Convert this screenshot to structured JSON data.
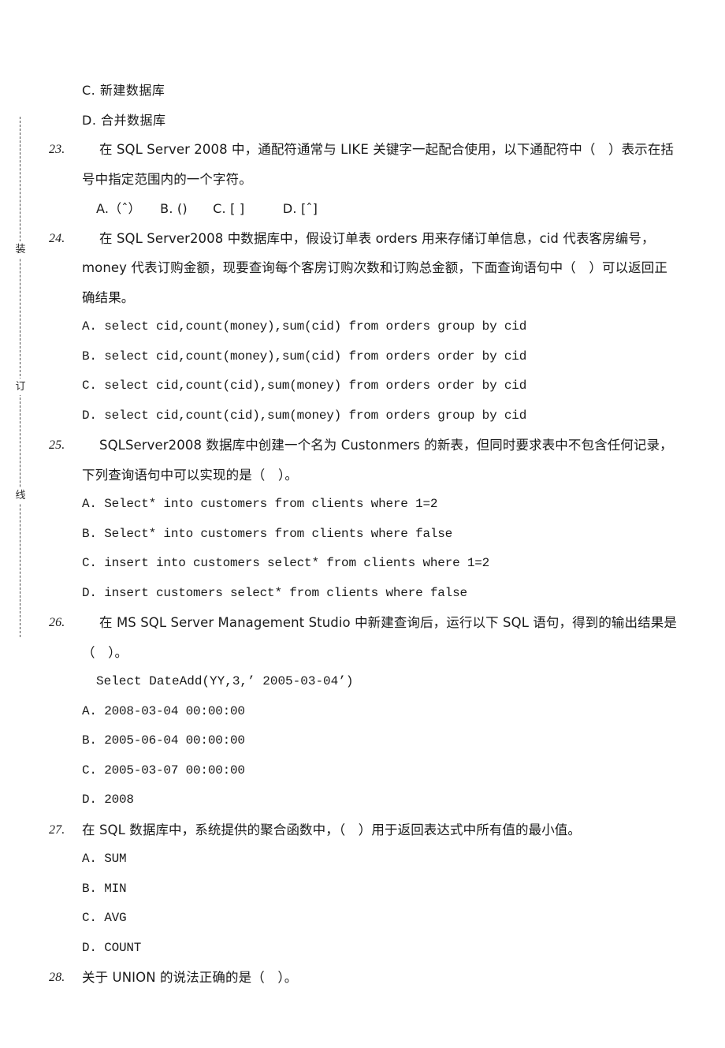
{
  "page": {
    "binding_margin": {
      "characters": [
        "装",
        "订",
        "线"
      ],
      "meaning_label": "binding-seal-line"
    }
  },
  "carryover_options": [
    {
      "label": "C.",
      "text": "新建数据库"
    },
    {
      "label": "D.",
      "text": "合并数据库"
    }
  ],
  "questions": [
    {
      "number": "23.",
      "stem_lines": [
        "在 SQL Server 2008 中，通配符通常与 LIKE 关键字一起配合使用，以下通配符中（　）表示在括号中指定范围内的一个字符。"
      ],
      "options_inline": "A.（ˆ）　　B. ()　　C. [ ]　　　D. [ˆ]",
      "options": []
    },
    {
      "number": "24.",
      "stem_lines": [
        "在 SQL Server2008 中数据库中，假设订单表 orders 用来存储订单信息，cid 代表客房编号，money 代表订购金额，现要查询每个客房订购次数和订购总金额，下面查询语句中（　）可以返回正确结果。"
      ],
      "options": [
        "A. select cid,count(money),sum(cid) from orders group by cid",
        "B. select cid,count(money),sum(cid) from orders order by cid",
        "C. select cid,count(cid),sum(money) from orders order by cid",
        "D. select cid,count(cid),sum(money) from orders group by cid"
      ]
    },
    {
      "number": "25.",
      "stem_lines": [
        "SQLServer2008 数据库中创建一个名为 Custonmers 的新表，但同时要求表中不包含任何记录，下列查询语句中可以实现的是（　）。"
      ],
      "options": [
        "A. Select* into customers from clients where 1=2",
        "B. Select* into customers from clients where false",
        "C. insert into customers select* from clients where 1=2",
        "D. insert customers select* from clients where false"
      ]
    },
    {
      "number": "26.",
      "stem_lines": [
        "在 MS SQL Server Management Studio 中新建查询后，运行以下 SQL 语句，得到的输出结果是（　）。"
      ],
      "code_line": "Select DateAdd(YY,3,’ 2005-03-04’)",
      "options": [
        "A. 2008-03-04 00:00:00",
        "B. 2005-06-04 00:00:00",
        "C. 2005-03-07 00:00:00",
        "D. 2008"
      ]
    },
    {
      "number": "27.",
      "stem_lines": [
        "在 SQL 数据库中，系统提供的聚合函数中，（　）用于返回表达式中所有值的最小值。"
      ],
      "options": [
        "A. SUM",
        "B. MIN",
        "C. AVG",
        "D. COUNT"
      ]
    },
    {
      "number": "28.",
      "stem_lines": [
        "关于 UNION 的说法正确的是（　）。"
      ],
      "options": []
    }
  ]
}
